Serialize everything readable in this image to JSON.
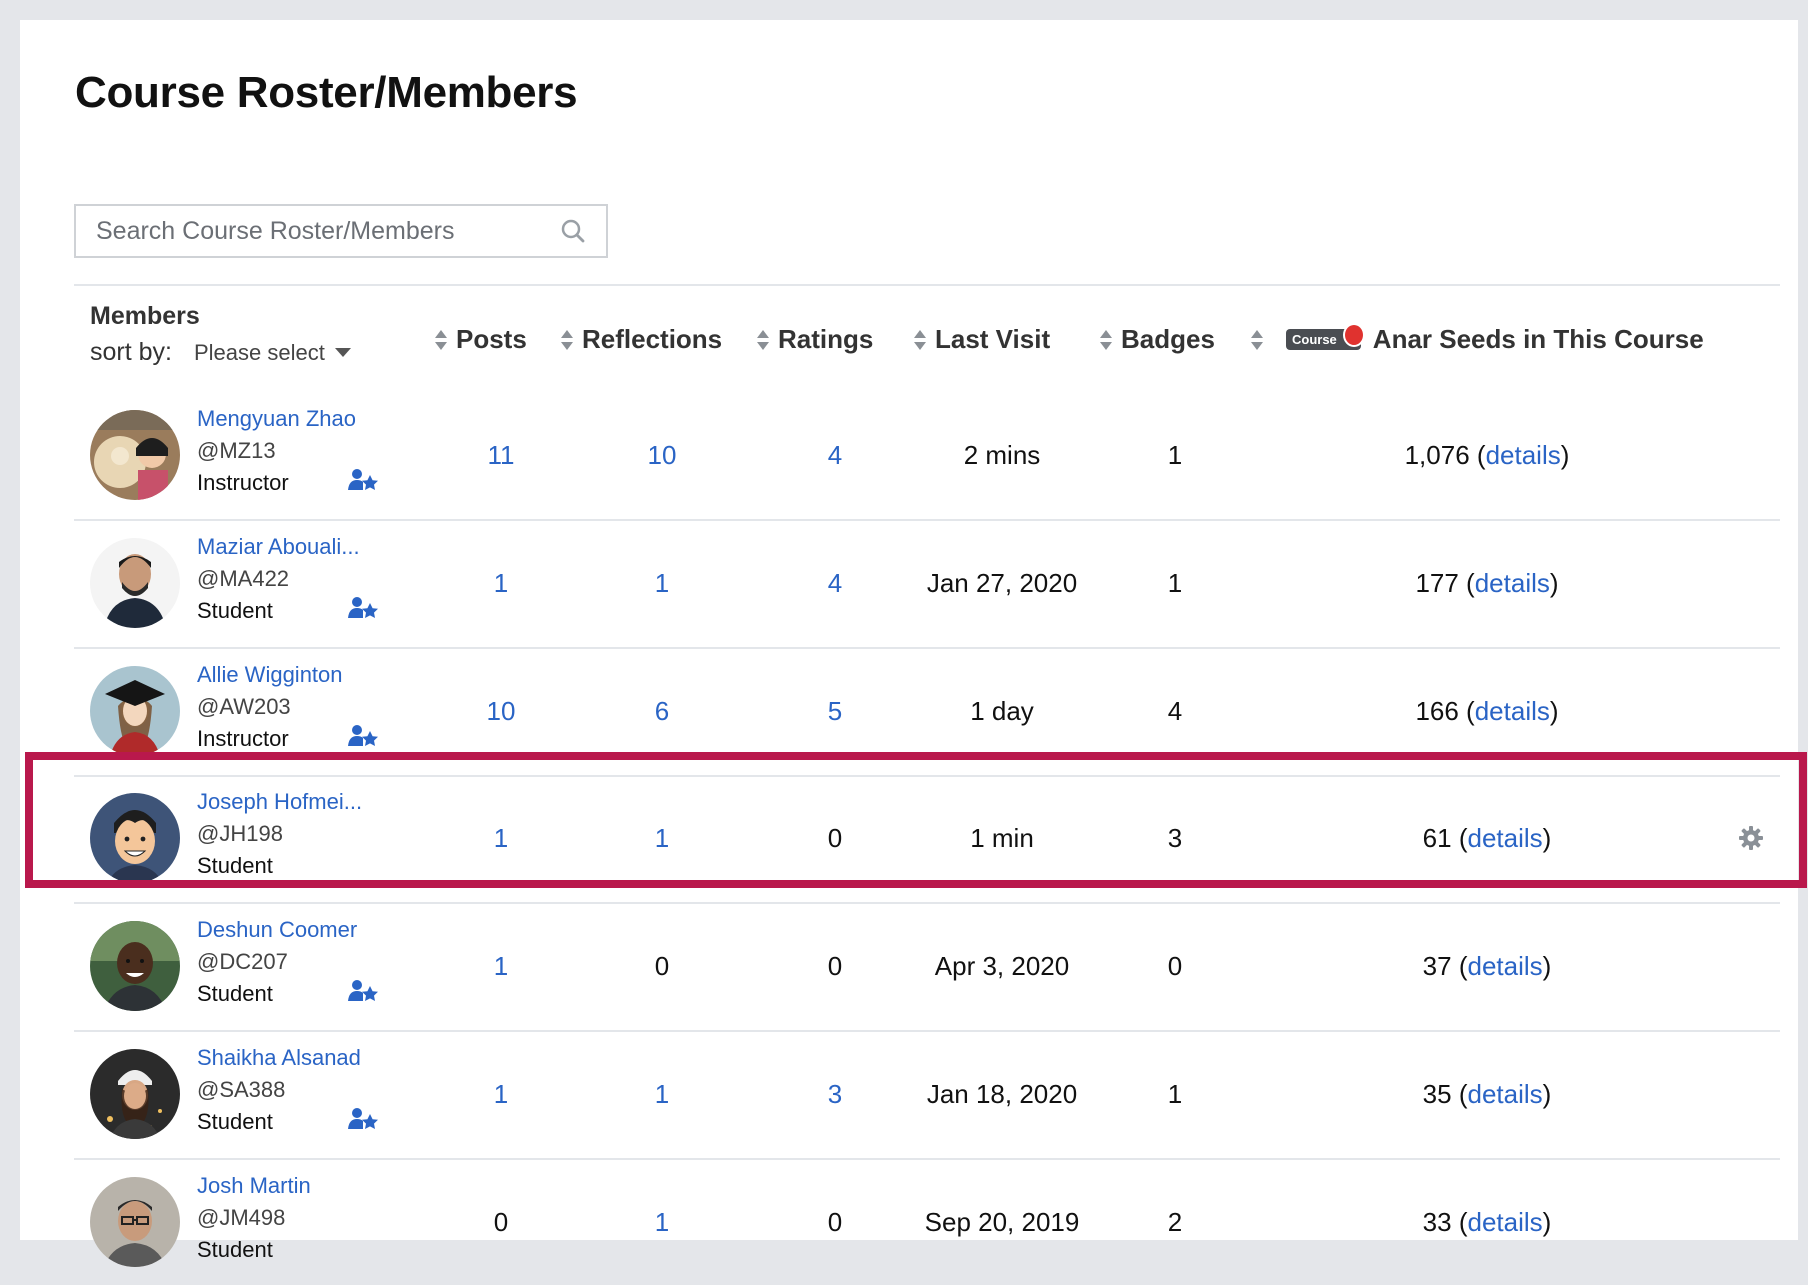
{
  "page": {
    "title": "Course Roster/Members"
  },
  "search": {
    "placeholder": "Search Course Roster/Members"
  },
  "header": {
    "members_label": "Members",
    "sort_by_label": "sort by:",
    "sort_select_value": "Please select",
    "columns": {
      "posts": "Posts",
      "reflections": "Reflections",
      "ratings": "Ratings",
      "last_visit": "Last Visit",
      "badges": "Badges",
      "seeds": "Anar Seeds in This Course",
      "course_tag": "Course"
    }
  },
  "details_label": "details",
  "members": [
    {
      "name": "Mengyuan Zhao",
      "handle": "@MZ13",
      "role": "Instructor",
      "posts": "11",
      "reflections": "10",
      "ratings": "4",
      "last_visit": "2 mins",
      "badges": "1",
      "seeds": "1,076"
    },
    {
      "name": "Maziar Abouali...",
      "handle": "@MA422",
      "role": "Student",
      "posts": "1",
      "reflections": "1",
      "ratings": "4",
      "last_visit": "Jan 27, 2020",
      "badges": "1",
      "seeds": "177"
    },
    {
      "name": "Allie Wigginton",
      "handle": "@AW203",
      "role": "Instructor",
      "posts": "10",
      "reflections": "6",
      "ratings": "5",
      "last_visit": "1 day",
      "badges": "4",
      "seeds": "166"
    },
    {
      "name": "Joseph Hofmei...",
      "handle": "@JH198",
      "role": "Student",
      "posts": "1",
      "reflections": "1",
      "ratings": "0",
      "last_visit": "1 min",
      "badges": "3",
      "seeds": "61"
    },
    {
      "name": "Deshun Coomer",
      "handle": "@DC207",
      "role": "Student",
      "posts": "1",
      "reflections": "0",
      "ratings": "0",
      "last_visit": "Apr 3, 2020",
      "badges": "0",
      "seeds": "37"
    },
    {
      "name": "Shaikha Alsanad",
      "handle": "@SA388",
      "role": "Student",
      "posts": "1",
      "reflections": "1",
      "ratings": "3",
      "last_visit": "Jan 18, 2020",
      "badges": "1",
      "seeds": "35"
    },
    {
      "name": "Josh Martin",
      "handle": "@JM498",
      "role": "Student",
      "posts": "0",
      "reflections": "1",
      "ratings": "0",
      "last_visit": "Sep 20, 2019",
      "badges": "2",
      "seeds": "33"
    }
  ],
  "colors": {
    "link": "#2a64c5",
    "highlight": "#b9184c",
    "background": "#e4e6ea"
  }
}
